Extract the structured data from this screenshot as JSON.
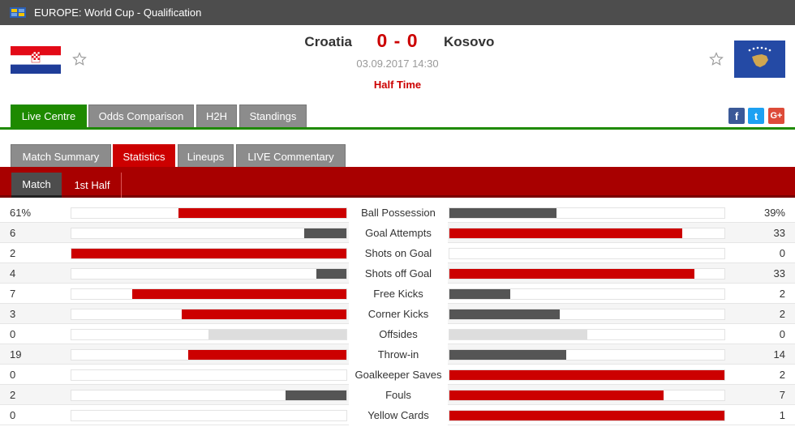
{
  "header": {
    "competition": "EUROPE: World Cup - Qualification",
    "home_team": "Croatia",
    "away_team": "Kosovo",
    "score": "0 - 0",
    "datetime": "03.09.2017 14:30",
    "status": "Half Time"
  },
  "icons": {
    "competition_flag": "europe-flag-icon",
    "home_flag": "croatia-flag-icon",
    "away_flag": "kosovo-flag-icon",
    "favorite": "star-outline-icon"
  },
  "main_tabs": [
    "Live Centre",
    "Odds Comparison",
    "H2H",
    "Standings"
  ],
  "social": {
    "facebook": "f",
    "twitter": "t",
    "google": "G+"
  },
  "detail_tabs": [
    "Match Summary",
    "Statistics",
    "Lineups",
    "LIVE Commentary"
  ],
  "period_tabs": [
    "Match",
    "1st Half"
  ],
  "colors": {
    "topbar": "#4d4d4d",
    "green_accent": "#1e8a00",
    "red_accent": "#cc0000",
    "dark_bar": "#555555",
    "neutral_bar": "#dddddd"
  },
  "stats": [
    {
      "label": "Ball Possession",
      "home": "61%",
      "away": "39%",
      "home_ratio": 0.61,
      "away_ratio": 0.39
    },
    {
      "label": "Goal Attempts",
      "home": "6",
      "away": "33",
      "home_ratio": 0.154,
      "away_ratio": 0.846
    },
    {
      "label": "Shots on Goal",
      "home": "2",
      "away": "0",
      "home_ratio": 1.0,
      "away_ratio": 0.0
    },
    {
      "label": "Shots off Goal",
      "home": "4",
      "away": "33",
      "home_ratio": 0.108,
      "away_ratio": 0.892
    },
    {
      "label": "Free Kicks",
      "home": "7",
      "away": "2",
      "home_ratio": 0.778,
      "away_ratio": 0.222
    },
    {
      "label": "Corner Kicks",
      "home": "3",
      "away": "2",
      "home_ratio": 0.6,
      "away_ratio": 0.4
    },
    {
      "label": "Offsides",
      "home": "0",
      "away": "0",
      "home_ratio": 0.5,
      "away_ratio": 0.5
    },
    {
      "label": "Throw-in",
      "home": "19",
      "away": "14",
      "home_ratio": 0.576,
      "away_ratio": 0.424
    },
    {
      "label": "Goalkeeper Saves",
      "home": "0",
      "away": "2",
      "home_ratio": 0.0,
      "away_ratio": 1.0
    },
    {
      "label": "Fouls",
      "home": "2",
      "away": "7",
      "home_ratio": 0.222,
      "away_ratio": 0.778
    },
    {
      "label": "Yellow Cards",
      "home": "0",
      "away": "1",
      "home_ratio": 0.0,
      "away_ratio": 1.0
    }
  ]
}
